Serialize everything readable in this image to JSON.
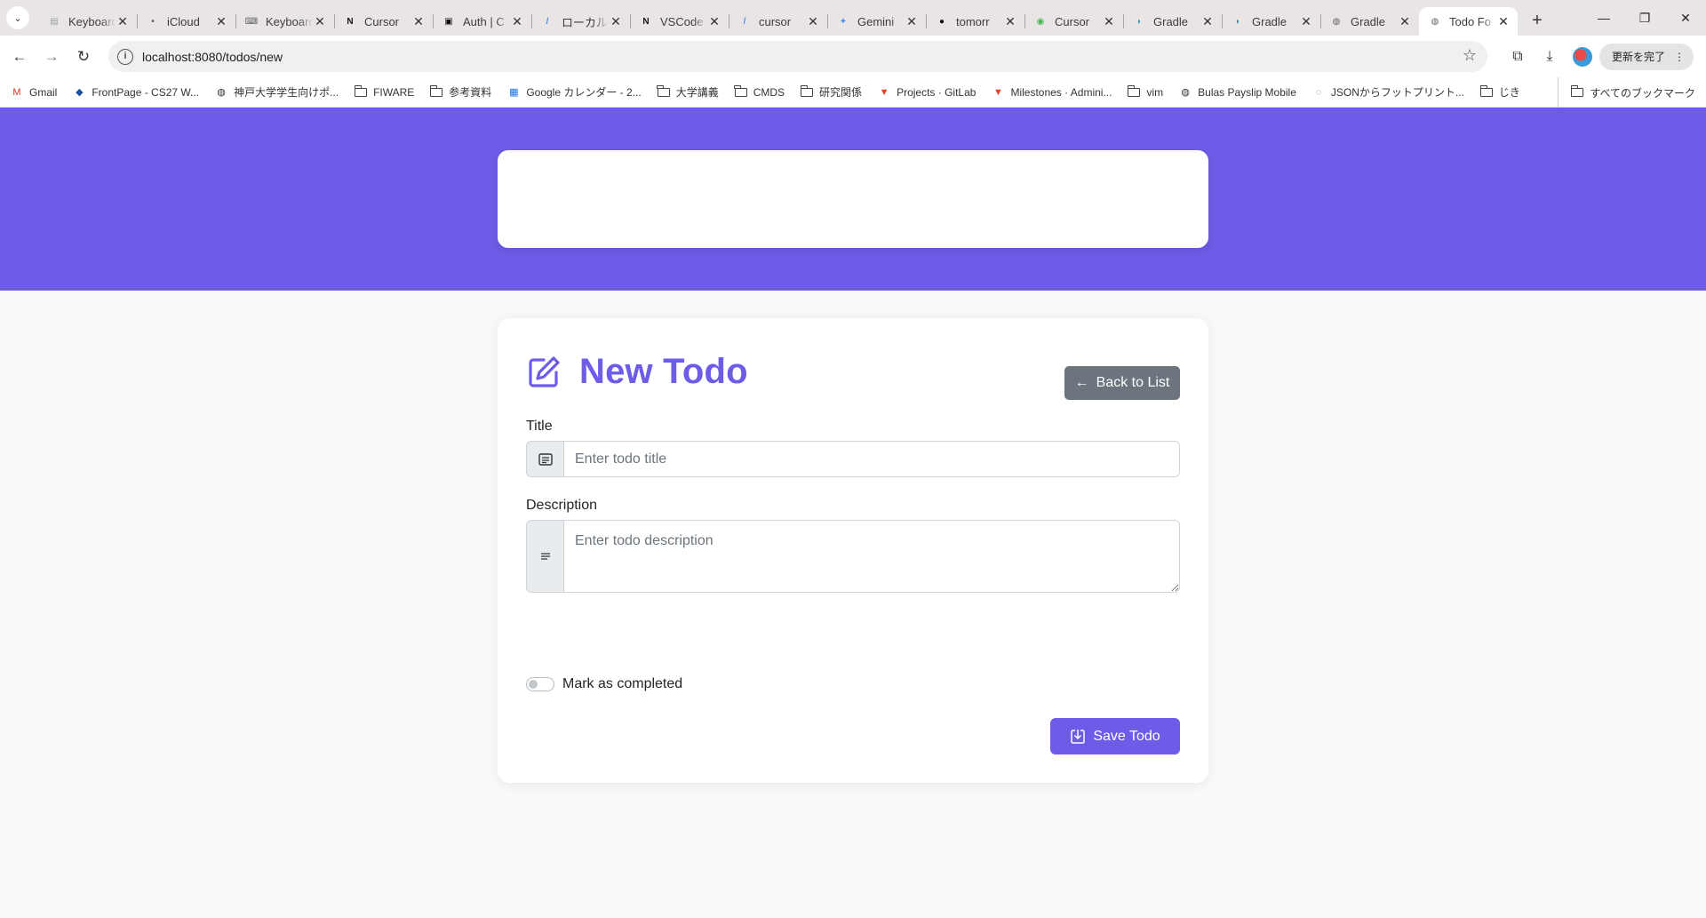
{
  "browser": {
    "tabs": [
      {
        "label": "Keyboard",
        "icon": "doc-icon",
        "color": "#9aa0a6"
      },
      {
        "label": "iCloud",
        "icon": "apple-icon",
        "color": "#5f6368"
      },
      {
        "label": "Keyboard",
        "icon": "keyboard-icon",
        "color": "#5f6368"
      },
      {
        "label": "Cursor",
        "icon": "notion-icon",
        "color": "#111111"
      },
      {
        "label": "Auth | C",
        "icon": "auth-icon",
        "color": "#111111"
      },
      {
        "label": "ローカル",
        "icon": "slash-icon",
        "color": "#4a8fe7"
      },
      {
        "label": "VSCode",
        "icon": "notion-icon",
        "color": "#111111"
      },
      {
        "label": "cursor",
        "icon": "slash-icon",
        "color": "#4a8fe7"
      },
      {
        "label": "Gemini",
        "icon": "gemini-icon",
        "color": "#4a8fe7"
      },
      {
        "label": "tomorr",
        "icon": "github-icon",
        "color": "#111111"
      },
      {
        "label": "Cursor",
        "icon": "cursor-icon",
        "color": "#43b649"
      },
      {
        "label": "Gradle",
        "icon": "gradle-icon",
        "color": "#209bc4"
      },
      {
        "label": "Gradle",
        "icon": "gradle-icon",
        "color": "#209bc4"
      },
      {
        "label": "Gradle",
        "icon": "globe-icon",
        "color": "#5f6368"
      },
      {
        "label": "Todo Fo",
        "icon": "globe-icon",
        "color": "#5f6368",
        "active": true
      }
    ],
    "url": "localhost:8080/todos/new",
    "update_label": "更新を完了",
    "bookmarks": [
      {
        "label": "Gmail",
        "icon": "gmail-icon"
      },
      {
        "label": "FrontPage - CS27 W...",
        "icon": "site-icon"
      },
      {
        "label": "神戸大学学生向けポ...",
        "icon": "globe-icon"
      },
      {
        "label": "FIWARE",
        "icon": "folder-icon"
      },
      {
        "label": "参考資料",
        "icon": "folder-icon"
      },
      {
        "label": "Google カレンダー - 2...",
        "icon": "calendar-icon"
      },
      {
        "label": "大学講義",
        "icon": "folder-icon"
      },
      {
        "label": "CMDS",
        "icon": "folder-icon"
      },
      {
        "label": "研究関係",
        "icon": "folder-icon"
      },
      {
        "label": "Projects · GitLab",
        "icon": "gitlab-icon"
      },
      {
        "label": "Milestones · Admini...",
        "icon": "gitlab-icon"
      },
      {
        "label": "vim",
        "icon": "folder-icon"
      },
      {
        "label": "Bulas Payslip Mobile",
        "icon": "globe-icon"
      },
      {
        "label": "JSONからフットプリント...",
        "icon": "doc-icon"
      },
      {
        "label": "じき",
        "icon": "folder-icon"
      }
    ],
    "all_bookmarks_label": "すべてのブックマーク"
  },
  "page": {
    "title": "New Todo",
    "back_button": "Back to List",
    "form": {
      "title_label": "Title",
      "title_placeholder": "Enter todo title",
      "title_value": "",
      "description_label": "Description",
      "description_placeholder": "Enter todo description",
      "description_value": "",
      "completed_label": "Mark as completed",
      "completed": false,
      "save_button": "Save Todo"
    }
  },
  "colors": {
    "accent": "#6c5ce7",
    "secondary_button": "#6c757d",
    "page_background": "#f8f9fb"
  }
}
